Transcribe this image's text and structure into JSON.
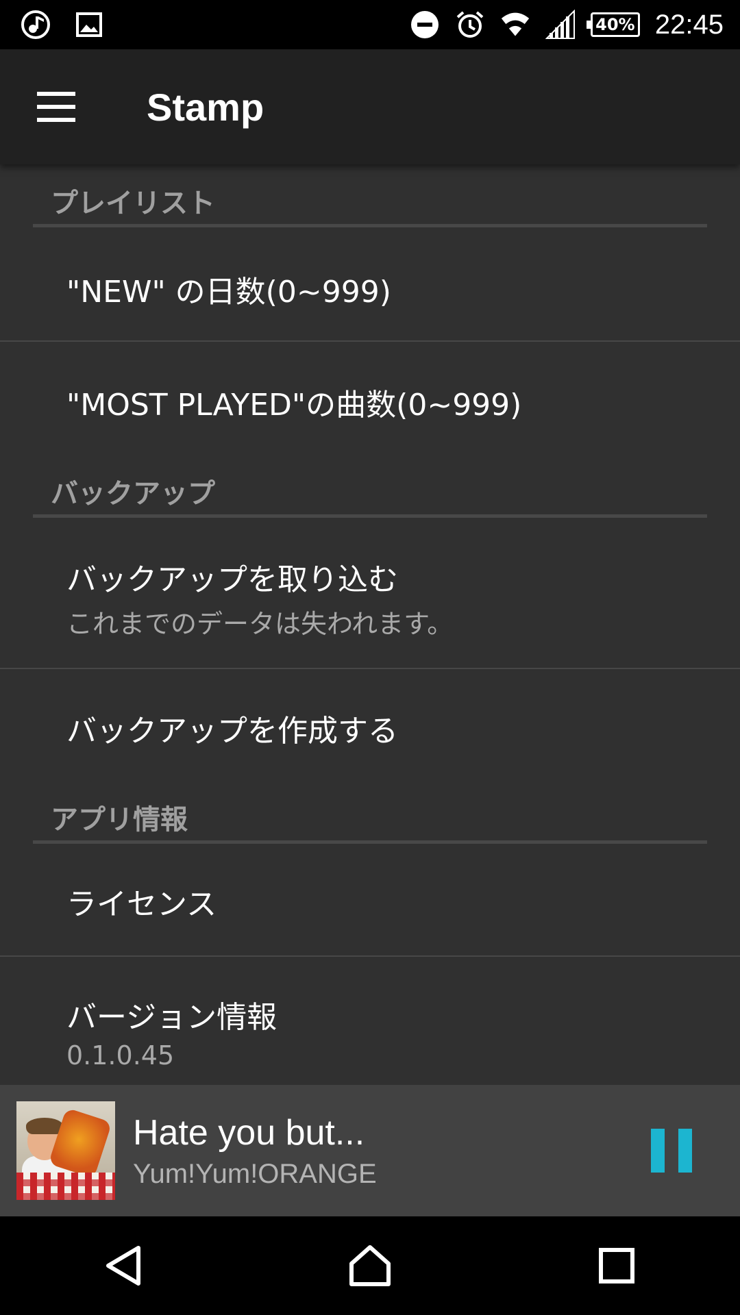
{
  "status_bar": {
    "left_icons": [
      "music-note-icon",
      "image-icon"
    ],
    "right_icons": [
      "do-not-disturb-icon",
      "alarm-icon",
      "wifi-icon",
      "signal-icon",
      "battery-icon"
    ],
    "battery_percent": "40%",
    "time": "22:45"
  },
  "app_bar": {
    "menu_icon": "hamburger-menu-icon",
    "title": "Stamp"
  },
  "settings": {
    "playlist_category": "プレイリスト",
    "new_days": "\"NEW\" の日数(0~999)",
    "most_played_count": "\"MOST PLAYED\"の曲数(0~999)",
    "backup_category": "バックアップ",
    "import_backup": {
      "title": "バックアップを取り込む",
      "summary": "これまでのデータは失われます。"
    },
    "create_backup": "バックアップを作成する",
    "app_info_category": "アプリ情報",
    "license": "ライセンス",
    "version": {
      "title": "バージョン情報",
      "summary": "0.1.0.45"
    }
  },
  "now_playing": {
    "title": "Hate you but...",
    "artist": "Yum!Yum!ORANGE",
    "pause_icon": "pause-icon",
    "accent_color": "#1cb5d0"
  },
  "nav_bar": {
    "icons": [
      "back-icon",
      "home-icon",
      "recents-icon"
    ]
  }
}
